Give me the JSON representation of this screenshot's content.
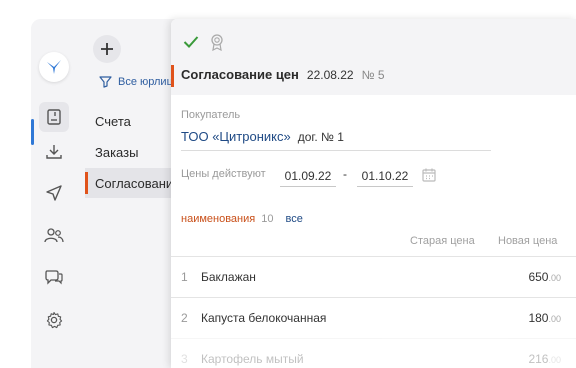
{
  "colors": {
    "accent_orange": "#e0531b",
    "accent_blue": "#2f78d6",
    "link_blue": "#1f4a85",
    "check_green": "#3a9a3a"
  },
  "rail": {
    "items": [
      {
        "icon": "document-icon",
        "active": true
      },
      {
        "icon": "download-icon",
        "active": false
      },
      {
        "icon": "send-icon",
        "active": false
      },
      {
        "icon": "contacts-icon",
        "active": false
      },
      {
        "icon": "chat-icon",
        "active": false
      },
      {
        "icon": "settings-icon",
        "active": false
      }
    ]
  },
  "nav": {
    "filter_label": "Все юрлица",
    "items": [
      {
        "label": "Счета",
        "active": false
      },
      {
        "label": "Заказы",
        "active": false
      },
      {
        "label": "Согласование цен",
        "active": true
      }
    ]
  },
  "doc": {
    "title": "Согласование цен",
    "date": "22.08.22",
    "number": "№ 5",
    "buyer_label": "Покупатель",
    "buyer_name": "ТОО «Цитроникс»",
    "contract": "дог. № 1",
    "prices_label": "Цены действуют",
    "date_from": "01.09.22",
    "date_sep": "-",
    "date_to": "01.10.22",
    "tab_names": "наименования",
    "tab_count": "10",
    "tab_all": "все",
    "col_old": "Старая цена",
    "col_new": "Новая цена",
    "items": [
      {
        "idx": "1",
        "name": "Баклажан",
        "price": "650",
        "cents": ".00"
      },
      {
        "idx": "2",
        "name": "Капуста белокочанная",
        "price": "180",
        "cents": ".00"
      },
      {
        "idx": "3",
        "name": "Картофель мытый",
        "price": "216",
        "cents": ".00"
      }
    ]
  }
}
